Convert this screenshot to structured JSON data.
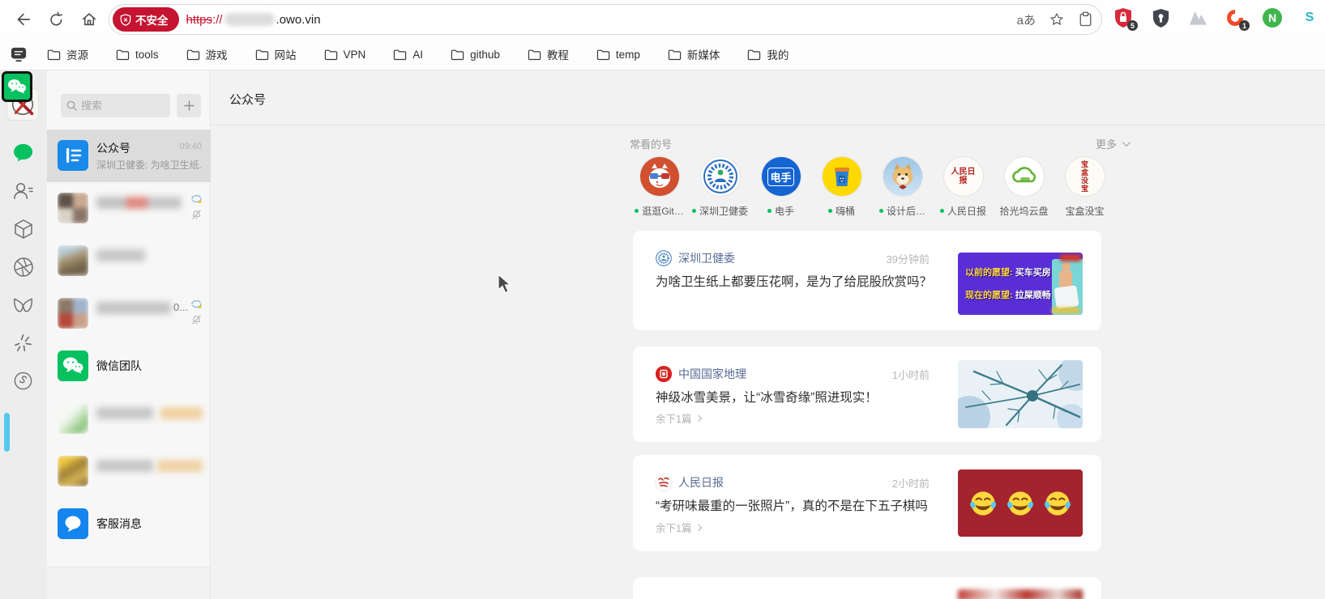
{
  "browser": {
    "security_badge": "不安全",
    "url_scheme": "https",
    "url_colon_slash": "://",
    "url_suffix": ".owo.vin",
    "translate_label": "aあ",
    "bookmarks": [
      "资源",
      "tools",
      "游戏",
      "网站",
      "VPN",
      "AI",
      "github",
      "教程",
      "temp",
      "新媒体",
      "我的"
    ],
    "ext_shield_badge": "5",
    "ext_c_badge": "1",
    "ext_n_letter": "N",
    "ext_s_letter": "S"
  },
  "chat": {
    "search_placeholder": "搜索",
    "official": {
      "title": "公众号",
      "time": "09:40",
      "preview": "深圳卫健委: 为啥卫生纸..."
    },
    "group_visible_suffix": "0...",
    "wechat_team": "微信团队",
    "service": "客服消息"
  },
  "main": {
    "title": "公众号",
    "often_label": "常看的号",
    "more_label": "更多",
    "accounts": [
      {
        "name": "逛逛Git…"
      },
      {
        "name": "深圳卫健委"
      },
      {
        "name": "电手",
        "logo_text": "电手"
      },
      {
        "name": "嗨桶"
      },
      {
        "name": "设计后…"
      },
      {
        "name": "人民日报",
        "logo_text": "人民日报"
      },
      {
        "name": "拾光坞云盘"
      },
      {
        "name": "宝盒没宝",
        "logo_text": "宝盒没宝"
      }
    ],
    "articles": [
      {
        "account": "深圳卫健委",
        "time": "39分钟前",
        "title": "为啥卫生纸上都要压花啊，是为了给屁股欣赏吗？",
        "thumb_line1_label": "以前的愿望:",
        "thumb_line1_value": "买车买房",
        "thumb_line2_label": "现在的愿望:",
        "thumb_line2_value": "拉屎顺畅"
      },
      {
        "account": "中国国家地理",
        "time": "1小时前",
        "title": "神级冰雪美景，让“冰雪奇缘”照进现实！",
        "footer": "余下1篇"
      },
      {
        "account": "人民日报",
        "time": "2小时前",
        "title": "“考研味最重的一张照片”，真的不是在下五子棋吗",
        "footer": "余下1篇"
      }
    ]
  }
}
